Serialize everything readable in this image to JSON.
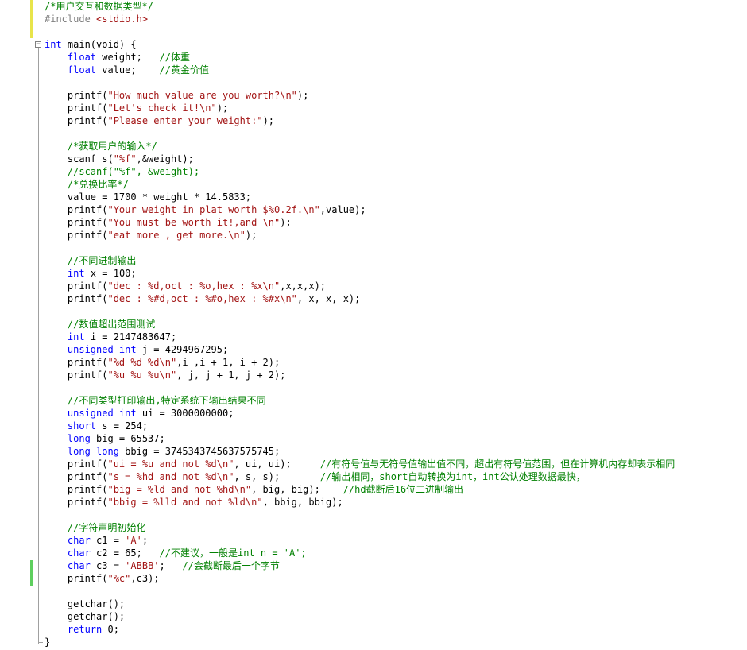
{
  "editor": {
    "fold_symbol": "⊟",
    "colors": {
      "keyword": "#0000ff",
      "comment": "#008000",
      "string": "#a31515",
      "preprocessor": "#808080",
      "default": "#000000",
      "modified_bar": "#e8e44a",
      "saved_bar": "#5fcf5f"
    },
    "lines": [
      [
        [
          "cm",
          "/*用户交互和数据类型*/"
        ]
      ],
      [
        [
          "pp",
          "#include "
        ],
        [
          "st",
          "<stdio.h>"
        ]
      ],
      [],
      [
        [
          "kw",
          "int"
        ],
        [
          "df",
          " main(void) {"
        ]
      ],
      [
        [
          "df",
          "    "
        ],
        [
          "kw",
          "float"
        ],
        [
          "df",
          " weight;   "
        ],
        [
          "cm",
          "//体重"
        ]
      ],
      [
        [
          "df",
          "    "
        ],
        [
          "kw",
          "float"
        ],
        [
          "df",
          " value;    "
        ],
        [
          "cm",
          "//黄金价值"
        ]
      ],
      [],
      [
        [
          "df",
          "    printf("
        ],
        [
          "st",
          "\"How much value are you worth?\\n\""
        ],
        [
          "df",
          ");"
        ]
      ],
      [
        [
          "df",
          "    printf("
        ],
        [
          "st",
          "\"Let's check it!\\n\""
        ],
        [
          "df",
          ");"
        ]
      ],
      [
        [
          "df",
          "    printf("
        ],
        [
          "st",
          "\"Please enter your weight:\""
        ],
        [
          "df",
          ");"
        ]
      ],
      [],
      [
        [
          "df",
          "    "
        ],
        [
          "cm",
          "/*获取用户的输入*/"
        ]
      ],
      [
        [
          "df",
          "    scanf_s("
        ],
        [
          "st",
          "\"%f\""
        ],
        [
          "df",
          ",&weight);"
        ]
      ],
      [
        [
          "df",
          "    "
        ],
        [
          "cm",
          "//scanf(\"%f\", &weight);"
        ]
      ],
      [
        [
          "df",
          "    "
        ],
        [
          "cm",
          "/*兑换比率*/"
        ]
      ],
      [
        [
          "df",
          "    value = 1700 * weight * 14.5833;"
        ]
      ],
      [
        [
          "df",
          "    printf("
        ],
        [
          "st",
          "\"Your weight in plat worth $%0.2f.\\n\""
        ],
        [
          "df",
          ",value);"
        ]
      ],
      [
        [
          "df",
          "    printf("
        ],
        [
          "st",
          "\"You must be worth it!,and \\n\""
        ],
        [
          "df",
          ");"
        ]
      ],
      [
        [
          "df",
          "    printf("
        ],
        [
          "st",
          "\"eat more , get more.\\n\""
        ],
        [
          "df",
          ");"
        ]
      ],
      [],
      [
        [
          "df",
          "    "
        ],
        [
          "cm",
          "//不同进制输出"
        ]
      ],
      [
        [
          "df",
          "    "
        ],
        [
          "kw",
          "int"
        ],
        [
          "df",
          " x = 100;"
        ]
      ],
      [
        [
          "df",
          "    printf("
        ],
        [
          "st",
          "\"dec : %d,oct : %o,hex : %x\\n\""
        ],
        [
          "df",
          ",x,x,x);"
        ]
      ],
      [
        [
          "df",
          "    printf("
        ],
        [
          "st",
          "\"dec : %#d,oct : %#o,hex : %#x\\n\""
        ],
        [
          "df",
          ", x, x, x);"
        ]
      ],
      [],
      [
        [
          "df",
          "    "
        ],
        [
          "cm",
          "//数值超出范围测试"
        ]
      ],
      [
        [
          "df",
          "    "
        ],
        [
          "kw",
          "int"
        ],
        [
          "df",
          " i = 2147483647;"
        ]
      ],
      [
        [
          "df",
          "    "
        ],
        [
          "kw",
          "unsigned int"
        ],
        [
          "df",
          " j = 4294967295;"
        ]
      ],
      [
        [
          "df",
          "    printf("
        ],
        [
          "st",
          "\"%d %d %d\\n\""
        ],
        [
          "df",
          ",i ,i + 1, i + 2);"
        ]
      ],
      [
        [
          "df",
          "    printf("
        ],
        [
          "st",
          "\"%u %u %u\\n\""
        ],
        [
          "df",
          ", j, j + 1, j + 2);"
        ]
      ],
      [],
      [
        [
          "df",
          "    "
        ],
        [
          "cm",
          "//不同类型打印输出,特定系统下输出结果不同"
        ]
      ],
      [
        [
          "df",
          "    "
        ],
        [
          "kw",
          "unsigned int"
        ],
        [
          "df",
          " ui = 3000000000;"
        ]
      ],
      [
        [
          "df",
          "    "
        ],
        [
          "kw",
          "short"
        ],
        [
          "df",
          " s = 254;"
        ]
      ],
      [
        [
          "df",
          "    "
        ],
        [
          "kw",
          "long"
        ],
        [
          "df",
          " big = 65537;"
        ]
      ],
      [
        [
          "df",
          "    "
        ],
        [
          "kw",
          "long long"
        ],
        [
          "df",
          " bbig = 3745343745637575745;"
        ]
      ],
      [
        [
          "df",
          "    printf("
        ],
        [
          "st",
          "\"ui = %u and not %d\\n\""
        ],
        [
          "df",
          ", ui, ui);     "
        ],
        [
          "cm",
          "//有符号值与无符号值输出值不同，超出有符号值范围，但在计算机内存却表示相同"
        ]
      ],
      [
        [
          "df",
          "    printf("
        ],
        [
          "st",
          "\"s = %hd and not %d\\n\""
        ],
        [
          "df",
          ", s, s);       "
        ],
        [
          "cm",
          "//输出相同，short自动转换为int，int公认处理数据最快，"
        ]
      ],
      [
        [
          "df",
          "    printf("
        ],
        [
          "st",
          "\"big = %ld and not %hd\\n\""
        ],
        [
          "df",
          ", big, big);    "
        ],
        [
          "cm",
          "//hd截断后16位二进制输出"
        ]
      ],
      [
        [
          "df",
          "    printf("
        ],
        [
          "st",
          "\"bbig = %lld and not %ld\\n\""
        ],
        [
          "df",
          ", bbig, bbig);"
        ]
      ],
      [],
      [
        [
          "df",
          "    "
        ],
        [
          "cm",
          "//字符声明初始化"
        ]
      ],
      [
        [
          "df",
          "    "
        ],
        [
          "kw",
          "char"
        ],
        [
          "df",
          " c1 = "
        ],
        [
          "st",
          "'A'"
        ],
        [
          "df",
          ";"
        ]
      ],
      [
        [
          "df",
          "    "
        ],
        [
          "kw",
          "char"
        ],
        [
          "df",
          " c2 = 65;   "
        ],
        [
          "cm",
          "//不建议，一般是int n = 'A';"
        ]
      ],
      [
        [
          "df",
          "    "
        ],
        [
          "kw",
          "char"
        ],
        [
          "df",
          " c3 = "
        ],
        [
          "st",
          "'ABBB'"
        ],
        [
          "df",
          ";   "
        ],
        [
          "cm",
          "//会截断最后一个字节"
        ]
      ],
      [
        [
          "df",
          "    printf("
        ],
        [
          "st",
          "\"%c\""
        ],
        [
          "df",
          ",c3);"
        ]
      ],
      [],
      [
        [
          "df",
          "    getchar();"
        ]
      ],
      [
        [
          "df",
          "    getchar();"
        ]
      ],
      [
        [
          "df",
          "    "
        ],
        [
          "kw",
          "return"
        ],
        [
          "df",
          " 0;"
        ]
      ],
      [
        [
          "df",
          "}"
        ]
      ]
    ]
  }
}
